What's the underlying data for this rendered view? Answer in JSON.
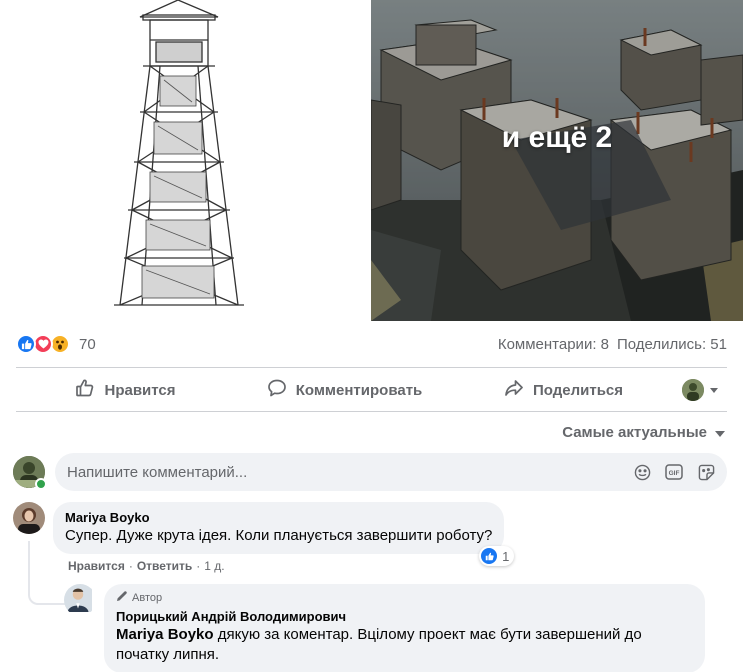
{
  "gallery": {
    "more_label": "и ещё 2"
  },
  "stats": {
    "reaction_count": "70",
    "comments": "Комментарии: 8",
    "shares": "Поделились: 51"
  },
  "actions": {
    "like": "Нравится",
    "comment": "Комментировать",
    "share": "Поделиться"
  },
  "sort": {
    "label": "Самые актуальные"
  },
  "composer": {
    "placeholder": "Напишите комментарий..."
  },
  "comments": [
    {
      "author": "Mariya Boyko",
      "text": "Супер. Дуже крута ідея. Коли планується завершити роботу?",
      "reaction_count": "1",
      "like_label": "Нравится",
      "reply_label": "Ответить",
      "time": "1 д."
    }
  ],
  "reply": {
    "badge": "Автор",
    "author": "Порицький Андрій Володимирович",
    "mention": "Mariya Boyko",
    "text": " дякую за коментар. Вцілому проект має бути завершений до початку липня."
  },
  "colors": {
    "accent": "#1877f2",
    "love": "#f33e58",
    "wow": "#f7b125",
    "muted_text": "#65676b",
    "bubble_bg": "#f0f2f5",
    "online": "#31a24c"
  }
}
